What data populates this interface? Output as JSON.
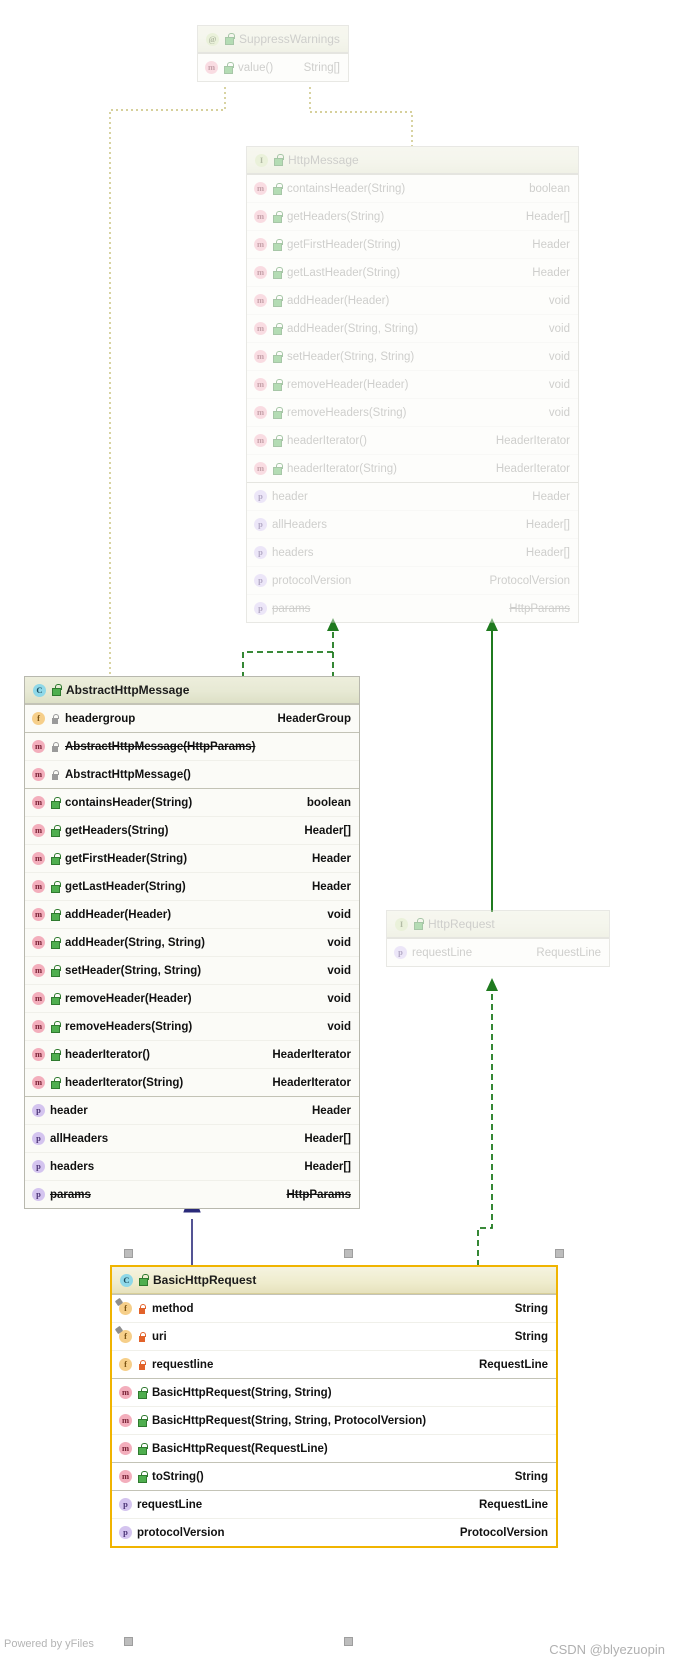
{
  "diagram": {
    "title": "Java class hierarchy UML diagram",
    "footer_left": "Powered by yFiles",
    "footer_right": "CSDN @blyezuopin",
    "colors": {
      "selection_border": "#f0b400",
      "inheritance_solid": "#2a2a7a",
      "realization_dashed": "#1f7a1f",
      "annotation_dotted": "#c8c07a"
    }
  },
  "boxes": {
    "suppress_warnings": {
      "name": "SuppressWarnings",
      "icon": "annotation-icon",
      "stereotype": "annotation",
      "faded": true,
      "sections": [
        {
          "rows": [
            {
              "icon": "method-icon",
              "visibility": "public",
              "name": "value()",
              "type": "String[]"
            }
          ]
        }
      ]
    },
    "http_message": {
      "name": "HttpMessage",
      "icon": "interface-icon",
      "stereotype": "interface",
      "faded": true,
      "sections": [
        {
          "rows": [
            {
              "icon": "method-icon",
              "visibility": "public",
              "name": "containsHeader(String)",
              "type": "boolean"
            },
            {
              "icon": "method-icon",
              "visibility": "public",
              "name": "getHeaders(String)",
              "type": "Header[]"
            },
            {
              "icon": "method-icon",
              "visibility": "public",
              "name": "getFirstHeader(String)",
              "type": "Header"
            },
            {
              "icon": "method-icon",
              "visibility": "public",
              "name": "getLastHeader(String)",
              "type": "Header"
            },
            {
              "icon": "method-icon",
              "visibility": "public",
              "name": "addHeader(Header)",
              "type": "void"
            },
            {
              "icon": "method-icon",
              "visibility": "public",
              "name": "addHeader(String, String)",
              "type": "void"
            },
            {
              "icon": "method-icon",
              "visibility": "public",
              "name": "setHeader(String, String)",
              "type": "void"
            },
            {
              "icon": "method-icon",
              "visibility": "public",
              "name": "removeHeader(Header)",
              "type": "void"
            },
            {
              "icon": "method-icon",
              "visibility": "public",
              "name": "removeHeaders(String)",
              "type": "void"
            },
            {
              "icon": "method-icon",
              "visibility": "public",
              "name": "headerIterator()",
              "type": "HeaderIterator"
            },
            {
              "icon": "method-icon",
              "visibility": "public",
              "name": "headerIterator(String)",
              "type": "HeaderIterator"
            }
          ]
        },
        {
          "rows": [
            {
              "icon": "property-icon",
              "visibility": "none",
              "name": "header",
              "type": "Header"
            },
            {
              "icon": "property-icon",
              "visibility": "none",
              "name": "allHeaders",
              "type": "Header[]"
            },
            {
              "icon": "property-icon",
              "visibility": "none",
              "name": "headers",
              "type": "Header[]"
            },
            {
              "icon": "property-icon",
              "visibility": "none",
              "name": "protocolVersion",
              "type": "ProtocolVersion"
            },
            {
              "icon": "property-icon",
              "visibility": "none",
              "name": "params",
              "type": "HttpParams",
              "deprecated": true
            }
          ]
        }
      ]
    },
    "abstract_http_message": {
      "name": "AbstractHttpMessage",
      "icon": "class-icon",
      "stereotype": "abstract class",
      "faded": false,
      "sections": [
        {
          "rows": [
            {
              "icon": "field-icon",
              "visibility": "protected",
              "name": "headergroup",
              "type": "HeaderGroup"
            }
          ]
        },
        {
          "rows": [
            {
              "icon": "method-icon",
              "visibility": "protected",
              "name": "AbstractHttpMessage(HttpParams)",
              "type": "",
              "deprecated": true
            },
            {
              "icon": "method-icon",
              "visibility": "protected",
              "name": "AbstractHttpMessage()",
              "type": ""
            }
          ]
        },
        {
          "rows": [
            {
              "icon": "method-icon",
              "visibility": "public",
              "name": "containsHeader(String)",
              "type": "boolean"
            },
            {
              "icon": "method-icon",
              "visibility": "public",
              "name": "getHeaders(String)",
              "type": "Header[]"
            },
            {
              "icon": "method-icon",
              "visibility": "public",
              "name": "getFirstHeader(String)",
              "type": "Header"
            },
            {
              "icon": "method-icon",
              "visibility": "public",
              "name": "getLastHeader(String)",
              "type": "Header"
            },
            {
              "icon": "method-icon",
              "visibility": "public",
              "name": "addHeader(Header)",
              "type": "void"
            },
            {
              "icon": "method-icon",
              "visibility": "public",
              "name": "addHeader(String, String)",
              "type": "void"
            },
            {
              "icon": "method-icon",
              "visibility": "public",
              "name": "setHeader(String, String)",
              "type": "void"
            },
            {
              "icon": "method-icon",
              "visibility": "public",
              "name": "removeHeader(Header)",
              "type": "void"
            },
            {
              "icon": "method-icon",
              "visibility": "public",
              "name": "removeHeaders(String)",
              "type": "void"
            },
            {
              "icon": "method-icon",
              "visibility": "public",
              "name": "headerIterator()",
              "type": "HeaderIterator"
            },
            {
              "icon": "method-icon",
              "visibility": "public",
              "name": "headerIterator(String)",
              "type": "HeaderIterator"
            }
          ]
        },
        {
          "rows": [
            {
              "icon": "property-icon",
              "visibility": "none",
              "name": "header",
              "type": "Header"
            },
            {
              "icon": "property-icon",
              "visibility": "none",
              "name": "allHeaders",
              "type": "Header[]"
            },
            {
              "icon": "property-icon",
              "visibility": "none",
              "name": "headers",
              "type": "Header[]"
            },
            {
              "icon": "property-icon",
              "visibility": "none",
              "name": "params",
              "type": "HttpParams",
              "deprecated": true
            }
          ]
        }
      ]
    },
    "http_request": {
      "name": "HttpRequest",
      "icon": "interface-icon",
      "stereotype": "interface",
      "faded": true,
      "sections": [
        {
          "rows": [
            {
              "icon": "property-icon",
              "visibility": "none",
              "name": "requestLine",
              "type": "RequestLine"
            }
          ]
        }
      ]
    },
    "basic_http_request": {
      "name": "BasicHttpRequest",
      "icon": "class-icon",
      "stereotype": "class",
      "faded": false,
      "selected": true,
      "sections": [
        {
          "rows": [
            {
              "icon": "field-icon",
              "visibility": "private",
              "static": true,
              "name": "method",
              "type": "String"
            },
            {
              "icon": "field-icon",
              "visibility": "private",
              "static": true,
              "name": "uri",
              "type": "String"
            },
            {
              "icon": "field-icon",
              "visibility": "private",
              "name": "requestline",
              "type": "RequestLine"
            }
          ]
        },
        {
          "rows": [
            {
              "icon": "method-icon",
              "visibility": "public",
              "name": "BasicHttpRequest(String, String)",
              "type": ""
            },
            {
              "icon": "method-icon",
              "visibility": "public",
              "name": "BasicHttpRequest(String, String, ProtocolVersion)",
              "type": ""
            },
            {
              "icon": "method-icon",
              "visibility": "public",
              "name": "BasicHttpRequest(RequestLine)",
              "type": ""
            }
          ]
        },
        {
          "rows": [
            {
              "icon": "method-icon",
              "visibility": "public",
              "name": "toString()",
              "type": "String"
            }
          ]
        },
        {
          "rows": [
            {
              "icon": "property-icon",
              "visibility": "none",
              "name": "requestLine",
              "type": "RequestLine"
            },
            {
              "icon": "property-icon",
              "visibility": "none",
              "name": "protocolVersion",
              "type": "ProtocolVersion"
            }
          ]
        }
      ]
    }
  },
  "relationships": [
    {
      "from": "AbstractHttpMessage",
      "to": "HttpMessage",
      "kind": "realization",
      "style": "dashed-green"
    },
    {
      "from": "BasicHttpRequest",
      "to": "AbstractHttpMessage",
      "kind": "generalization",
      "style": "solid-navy"
    },
    {
      "from": "BasicHttpRequest",
      "to": "HttpRequest",
      "kind": "realization",
      "style": "dashed-green"
    },
    {
      "from": "HttpRequest",
      "to": "HttpMessage",
      "kind": "realization",
      "style": "solid-green"
    },
    {
      "from": "SuppressWarnings",
      "to": "AbstractHttpMessage",
      "kind": "annotation",
      "style": "dotted-olive"
    },
    {
      "from": "SuppressWarnings",
      "to": "HttpMessage",
      "kind": "annotation",
      "style": "dotted-olive"
    }
  ]
}
